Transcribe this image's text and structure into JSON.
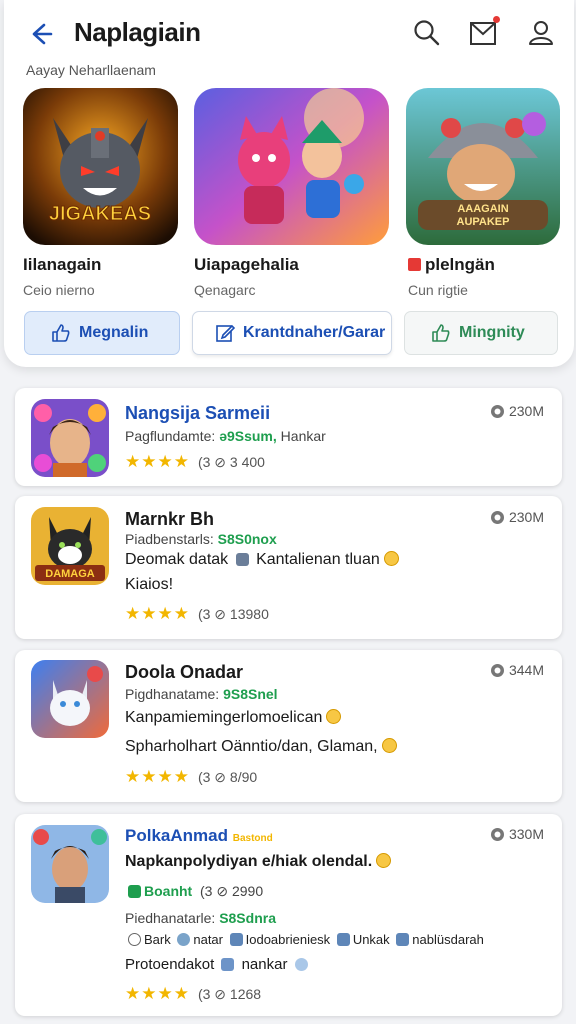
{
  "header": {
    "title": "Naplagiain",
    "subtitle": "Aayay Neharllaenam"
  },
  "featured": [
    {
      "name": "Iilanagain",
      "sub": "Ceio nierno",
      "art_text": "JIGAKEAS"
    },
    {
      "name": "Uiapagehalia",
      "sub": "Qenagarc"
    },
    {
      "name": "plelngän",
      "sub": "Cun rigtie",
      "art_text_1": "AAAGAIN",
      "art_text_2": "AUPAKEP"
    }
  ],
  "actions": [
    {
      "label": "Megnalin",
      "icon": "thumbs-up-icon"
    },
    {
      "label": "Krantdnaher/Garar",
      "icon": "edit-icon"
    },
    {
      "label": "Mingnity",
      "icon": "thumbs-up-icon"
    }
  ],
  "cards": [
    {
      "title": "Nangsija Sarmeii",
      "line1_prefix": "Pagflundamte:",
      "line1_green": "ə9Ssum,",
      "line1_suffix": "Hankar",
      "size": "230M",
      "rating_text": "(3 ⊘ 3 400"
    },
    {
      "title": "Marnkr Bh",
      "line1_prefix": "Piadbenstarls:",
      "line1_green": "S8S0nox",
      "desc1": "Deomak datak",
      "desc1b": "Kantalienan tluan",
      "desc2": "Kiaios!",
      "size": "230M",
      "rating_text": "(3 ⊘ 13980",
      "art_text": "DAMAGA"
    },
    {
      "title": "Doola Onadar",
      "line1_prefix": "Pigdhanatame:",
      "line1_green": "9S8Snel",
      "desc1": "Kanpamiemingerlomoelican",
      "desc2": "Spharholhart Oänntio/dan, Glaman,",
      "size": "344M",
      "rating_text": "(3 ⊘ 8/90"
    },
    {
      "title": "PolkaAnmad",
      "title_tag": "Bastond",
      "desc0": "Napkanpolydiyan e/hiak olendal.",
      "badge": "Boanht",
      "badge_rating": "(3 ⊘ 2990",
      "line1_prefix": "Piedhanatarle:",
      "line1_green": "S8Sdnra",
      "tag1": "Bark",
      "tag2": "natar",
      "tag3": "Iodoabrieniesk",
      "tag4": "Unkak",
      "tag5": "nablüsdarah",
      "desc2": "Protoendakot",
      "desc2b": "nankar",
      "size": "330M",
      "rating_text": "(3 ⊘ 1268"
    }
  ],
  "stars": "★★★★",
  "colors": {
    "accent": "#1c4fb4",
    "green": "#1e9e4e",
    "star": "#f2b600"
  }
}
